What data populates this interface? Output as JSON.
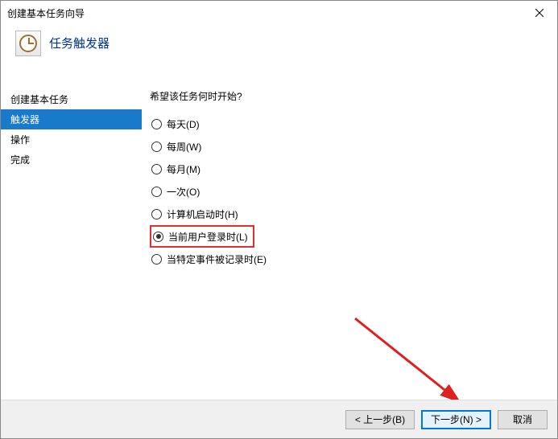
{
  "window": {
    "title": "创建基本任务向导"
  },
  "header": {
    "title": "任务触发器"
  },
  "sidebar": {
    "items": [
      {
        "label": "创建基本任务"
      },
      {
        "label": "触发器"
      },
      {
        "label": "操作"
      },
      {
        "label": "完成"
      }
    ],
    "selected_index": 1
  },
  "main": {
    "prompt": "希望该任务何时开始?",
    "options": [
      {
        "label": "每天(D)"
      },
      {
        "label": "每周(W)"
      },
      {
        "label": "每月(M)"
      },
      {
        "label": "一次(O)"
      },
      {
        "label": "计算机启动时(H)"
      },
      {
        "label": "当前用户登录时(L)"
      },
      {
        "label": "当特定事件被记录时(E)"
      }
    ],
    "selected_index": 5,
    "highlight_index": 5
  },
  "footer": {
    "back": "< 上一步(B)",
    "next": "下一步(N) >",
    "cancel": "取消"
  }
}
